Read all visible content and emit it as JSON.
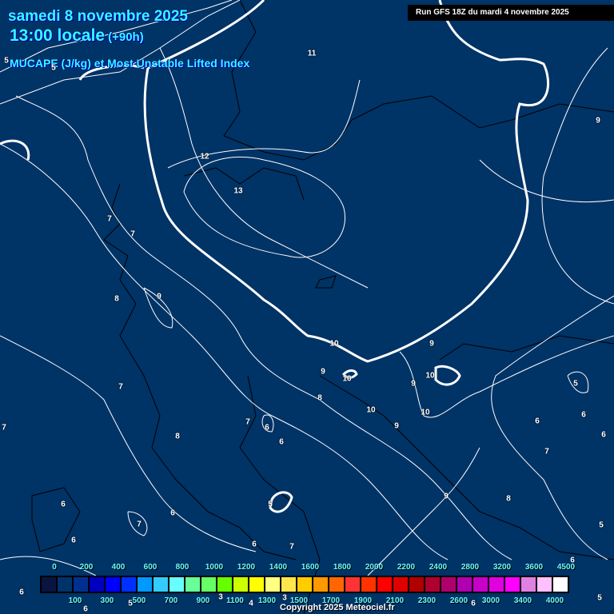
{
  "header": {
    "date": "samedi 8 novembre 2025",
    "time": "13:00 locale",
    "lead": "(+90h)",
    "parameter": "MUCAPE (J/kg) et Most Unstable Lifted Index",
    "run": "Run GFS 18Z du mardi 4 novembre 2025"
  },
  "colors": {
    "background": "#003366",
    "contour": "#ffffff",
    "coastline": "#000000"
  },
  "contour_labels": [
    "5",
    "5",
    "11",
    "9",
    "12",
    "13",
    "7",
    "7",
    "8",
    "9",
    "10",
    "9",
    "9",
    "10",
    "10",
    "9",
    "7",
    "5",
    "8",
    "10",
    "10",
    "9",
    "6",
    "6",
    "7",
    "6",
    "7",
    "8",
    "6",
    "6",
    "7",
    "5",
    "9",
    "8",
    "6",
    "6",
    "7",
    "5",
    "6",
    "6",
    "7",
    "6",
    "6",
    "6",
    "5",
    "3",
    "4",
    "3",
    "6",
    "5"
  ],
  "colorbar": {
    "colors": [
      "#0a1440",
      "#00336b",
      "#00308f",
      "#0000c0",
      "#0000ff",
      "#0030ff",
      "#0099ff",
      "#33ccff",
      "#66ffff",
      "#66ff99",
      "#66ff66",
      "#66ff00",
      "#ccff00",
      "#ffff00",
      "#ffff80",
      "#ffe64d",
      "#ffcc00",
      "#ff9900",
      "#ff6600",
      "#ff3333",
      "#ff3300",
      "#ff0000",
      "#e00000",
      "#b00000",
      "#b00030",
      "#b0006b",
      "#b000b0",
      "#c800c8",
      "#e000e0",
      "#ff00ff",
      "#e080e0",
      "#ffc0ff",
      "#ffffff"
    ],
    "top_labels": [
      "0",
      "200",
      "400",
      "600",
      "800",
      "1000",
      "1200",
      "1400",
      "1600",
      "1800",
      "2000",
      "2200",
      "2400",
      "2800",
      "3200",
      "3600",
      "4500"
    ],
    "bottom_labels": [
      "100",
      "300",
      "500",
      "700",
      "900",
      "1100",
      "1300",
      "1500",
      "1700",
      "1900",
      "2100",
      "2300",
      "2600",
      "3000",
      "3400",
      "4000"
    ]
  },
  "footer": {
    "copyright": "Copyright 2025 Meteociel.fr"
  }
}
